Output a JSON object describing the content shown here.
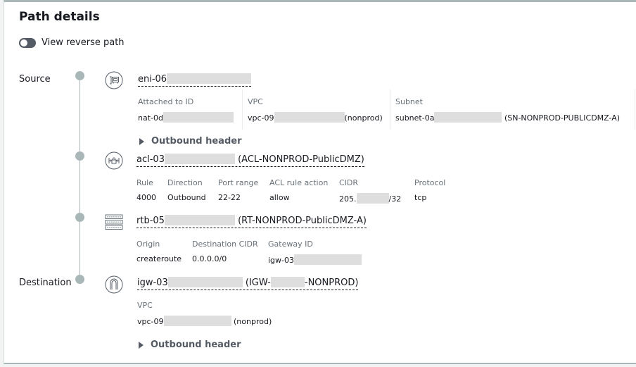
{
  "panel": {
    "title": "Path details",
    "reverse_toggle": {
      "label": "View reverse path",
      "checked": false
    }
  },
  "steps": {
    "source_label": "Source",
    "destination_label": "Destination"
  },
  "eni": {
    "icon": "network-interface-icon",
    "id_prefix": "eni-06",
    "fields": [
      {
        "key": "Attached to ID",
        "value_prefix": "nat-0d",
        "value_suffix": ""
      },
      {
        "key": "VPC",
        "value_prefix": "vpc-09",
        "value_suffix": "(nonprod)"
      },
      {
        "key": "Subnet",
        "value_prefix": "subnet-0a",
        "value_suffix": "(SN-NONPROD-PUBLICDMZ-A)"
      }
    ],
    "expander": "Outbound header"
  },
  "acl": {
    "icon": "network-acl-icon",
    "id_prefix": "acl-03",
    "name": "(ACL-NONPROD-PublicDMZ)",
    "fields": [
      {
        "key": "Rule",
        "value": "4000"
      },
      {
        "key": "Direction",
        "value": "Outbound"
      },
      {
        "key": "Port range",
        "value": "22-22"
      },
      {
        "key": "ACL rule action",
        "value": "allow"
      },
      {
        "key": "CIDR",
        "value_prefix": "205.",
        "value_suffix": "/32"
      },
      {
        "key": "Protocol",
        "value": "tcp"
      }
    ]
  },
  "rtb": {
    "icon": "route-table-icon",
    "id_prefix": "rtb-05",
    "name": "(RT-NONPROD-PublicDMZ-A)",
    "fields": [
      {
        "key": "Origin",
        "value": "createroute"
      },
      {
        "key": "Destination CIDR",
        "value": "0.0.0.0/0"
      },
      {
        "key": "Gateway ID",
        "value_prefix": "igw-03"
      }
    ]
  },
  "igw": {
    "icon": "internet-gateway-icon",
    "id_prefix": "igw-03",
    "name_prefix": "(IGW-",
    "name_suffix": "-NONPROD)",
    "fields": [
      {
        "key": "VPC",
        "value_prefix": "vpc-09",
        "value_suffix": "(nonprod)"
      }
    ],
    "expander": "Outbound header"
  }
}
